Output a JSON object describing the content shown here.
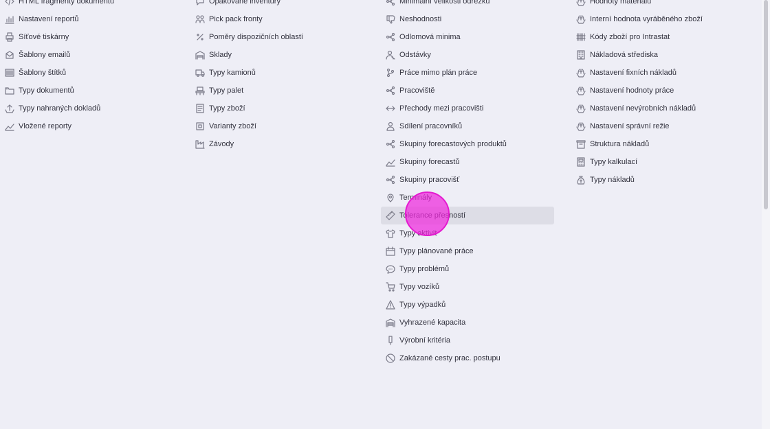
{
  "columns": [
    {
      "items": [
        {
          "label": "HTML fragmenty dokumentů",
          "icon": "code-icon"
        },
        {
          "label": "Nastavení reportů",
          "icon": "bar-chart-icon"
        },
        {
          "label": "Síťové tiskárny",
          "icon": "printer-icon"
        },
        {
          "label": "Šablony emailů",
          "icon": "email-template-icon"
        },
        {
          "label": "Šablony štítků",
          "icon": "barcode-icon"
        },
        {
          "label": "Typy dokumentů",
          "icon": "folder-icon"
        },
        {
          "label": "Typy nahraných dokladů",
          "icon": "upload-icon"
        },
        {
          "label": "Vložené reporty",
          "icon": "line-chart-icon"
        }
      ]
    },
    {
      "items": [
        {
          "label": "Opakované inventury",
          "icon": "chat-icon"
        },
        {
          "label": "Pick pack fronty",
          "icon": "people-icon"
        },
        {
          "label": "Poměry dispozičních oblastí",
          "icon": "percent-icon"
        },
        {
          "label": "Sklady",
          "icon": "warehouse-icon"
        },
        {
          "label": "Typy kamionů",
          "icon": "truck-icon"
        },
        {
          "label": "Typy palet",
          "icon": "pallet-icon"
        },
        {
          "label": "Typy zboží",
          "icon": "list-box-icon"
        },
        {
          "label": "Varianty zboží",
          "icon": "variant-box-icon"
        },
        {
          "label": "Závody",
          "icon": "factory-icon"
        }
      ]
    },
    {
      "items": [
        {
          "label": "Minimální velikosti odřezků",
          "icon": "network-icon"
        },
        {
          "label": "Neshodnosti",
          "icon": "thumb-down-icon"
        },
        {
          "label": "Odlomová minima",
          "icon": "network-icon"
        },
        {
          "label": "Odstávky",
          "icon": "person-off-icon"
        },
        {
          "label": "Práce mimo plán práce",
          "icon": "branch-icon"
        },
        {
          "label": "Pracoviště",
          "icon": "network-icon"
        },
        {
          "label": "Přechody mezi pracovišti",
          "icon": "arrows-horizontal-icon"
        },
        {
          "label": "Sdílení pracovníků",
          "icon": "person-icon"
        },
        {
          "label": "Skupiny forecastových produktů",
          "icon": "network-icon"
        },
        {
          "label": "Skupiny forecastů",
          "icon": "line-chart-icon"
        },
        {
          "label": "Skupiny pracovišť",
          "icon": "network-icon"
        },
        {
          "label": "Terminály",
          "icon": "map-pin-icon"
        },
        {
          "label": "Tolerance přesností",
          "icon": "ruler-icon"
        },
        {
          "label": "Typy aktivit",
          "icon": "shirt-icon"
        },
        {
          "label": "Typy plánované práce",
          "icon": "calendar-icon"
        },
        {
          "label": "Typy problémů",
          "icon": "speech-bubble-icon"
        },
        {
          "label": "Typy vozíků",
          "icon": "cart-icon"
        },
        {
          "label": "Typy výpadků",
          "icon": "warning-icon"
        },
        {
          "label": "Vyhrazené kapacita",
          "icon": "garage-icon"
        },
        {
          "label": "Výrobní kritéria",
          "icon": "gauge-icon"
        },
        {
          "label": "Zakázané cesty prac. postupu",
          "icon": "prohibited-icon"
        }
      ]
    },
    {
      "items": [
        {
          "label": "Hodnoty materiálu",
          "icon": "coins-hand-icon"
        },
        {
          "label": "Interní hodnota vyráběného zboží",
          "icon": "coins-hand-icon"
        },
        {
          "label": "Kódy zboží pro Intrastat",
          "icon": "barcode-lines-icon"
        },
        {
          "label": "Nákladová střediska",
          "icon": "building-icon"
        },
        {
          "label": "Nastavení fixních nákladů",
          "icon": "coins-hand-icon"
        },
        {
          "label": "Nastavení hodnoty práce",
          "icon": "coins-hand-icon"
        },
        {
          "label": "Nastavení nevýrobních nákladů",
          "icon": "coins-hand-icon"
        },
        {
          "label": "Nastavení správní režie",
          "icon": "coins-hand-icon"
        },
        {
          "label": "Struktura nákladů",
          "icon": "box-icon"
        },
        {
          "label": "Typy kalkulací",
          "icon": "calculator-icon"
        },
        {
          "label": "Typy nákladů",
          "icon": "money-bag-icon"
        }
      ]
    }
  ],
  "hovered_item": "Tolerance přesností",
  "colors": {
    "background": "#eeeef6",
    "hover_background": "#dddde6",
    "text": "#33333f",
    "icon": "#7a7a88",
    "cursor_highlight": "#e41ad0"
  }
}
